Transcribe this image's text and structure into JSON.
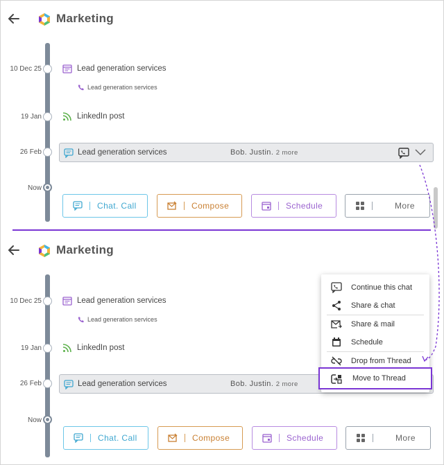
{
  "top": {
    "title": "Marketing",
    "timeline": [
      {
        "date": "10 Dec 25",
        "label": "Lead generation services",
        "sub": "Lead generation services"
      },
      {
        "date": "19 Jan",
        "label": "LinkedIn post"
      },
      {
        "date": "26 Feb",
        "label": "Lead generation services",
        "people": "Bob. Justin.",
        "more": "2 more"
      },
      {
        "date": "Now"
      }
    ],
    "buttons": {
      "chat": "Chat. Call",
      "compose": "Compose",
      "schedule": "Schedule",
      "more": "More"
    }
  },
  "bottom": {
    "title": "Marketing",
    "timeline": [
      {
        "date": "10 Dec 25",
        "label": "Lead generation services",
        "sub": "Lead generation services"
      },
      {
        "date": "19 Jan",
        "label": "LinkedIn post"
      },
      {
        "date": "26 Feb",
        "label": "Lead generation services",
        "people": "Bob. Justin.",
        "more": "2 more"
      },
      {
        "date": "Now"
      }
    ],
    "buttons": {
      "chat": "Chat. Call",
      "compose": "Compose",
      "schedule": "Schedule",
      "more": "More"
    }
  },
  "menu": {
    "items": [
      {
        "label": "Continue this chat",
        "icon": "chat-bubble-icon"
      },
      {
        "label": "Share & chat",
        "icon": "share-icon"
      },
      {
        "label": "Share & mail",
        "icon": "mail-forward-icon"
      },
      {
        "label": "Schedule",
        "icon": "calendar-icon"
      },
      {
        "label": "Drop from Thread",
        "icon": "unlink-icon"
      },
      {
        "label": "Move to Thread",
        "icon": "move-thread-icon"
      }
    ]
  },
  "colors": {
    "accent": "#7a35d4",
    "chat": "#3fa7d0",
    "compose": "#c98033",
    "schedule": "#9a62cf",
    "rail": "#7d8a99"
  }
}
